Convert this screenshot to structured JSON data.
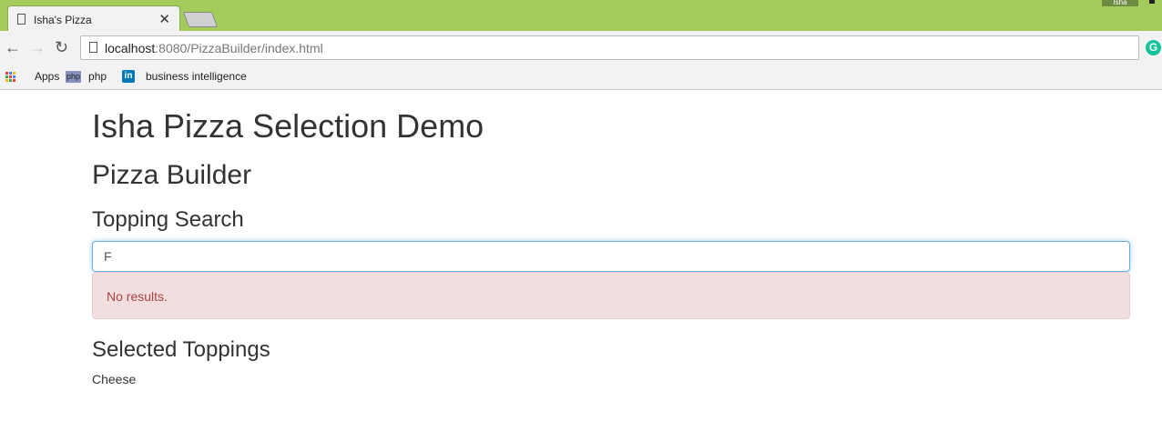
{
  "browser": {
    "tab_title": "Isha's Pizza",
    "url_host": "localhost",
    "url_rest": ":8080/PizzaBuilder/index.html",
    "user": "Isha",
    "bookmarks": [
      {
        "label": "Apps"
      },
      {
        "label": "php"
      },
      {
        "label": "business intelligence"
      }
    ],
    "extension_letter": "G"
  },
  "page": {
    "title": "Isha Pizza Selection Demo",
    "subtitle": "Pizza Builder",
    "search_heading": "Topping Search",
    "search_value": "F",
    "no_results": "No results.",
    "selected_heading": "Selected Toppings",
    "selected": [
      "Cheese"
    ]
  }
}
